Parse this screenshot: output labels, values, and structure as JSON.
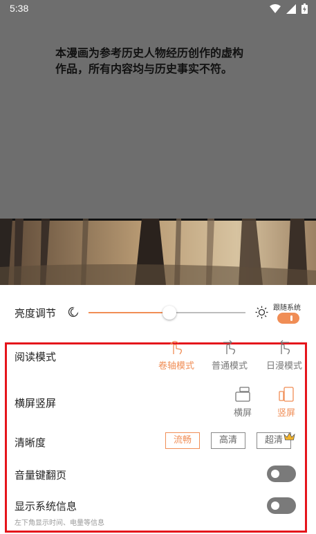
{
  "status": {
    "time": "5:38"
  },
  "disclaimer": {
    "line1": "本漫画为参考历史人物经历创作的虚构",
    "line2": "作品，所有内容均与历史事实不符。"
  },
  "brightness": {
    "label": "亮度调节",
    "follow_system_label": "跟随系统",
    "level": 0.5,
    "follow_system_on": true
  },
  "reading_mode": {
    "label": "阅读模式",
    "options": [
      {
        "label": "卷轴模式",
        "icon": "scroll-hand-icon",
        "active": true
      },
      {
        "label": "普通模式",
        "icon": "swipe-hand-icon",
        "active": false
      },
      {
        "label": "日漫模式",
        "icon": "swipe-back-hand-icon",
        "active": false
      }
    ]
  },
  "orientation": {
    "label": "横屏竖屏",
    "options": [
      {
        "label": "横屏",
        "icon": "landscape-icon",
        "active": false
      },
      {
        "label": "竖屏",
        "icon": "portrait-icon",
        "active": true
      }
    ]
  },
  "quality": {
    "label": "清晰度",
    "options": [
      {
        "label": "流畅",
        "active": true
      },
      {
        "label": "高清",
        "active": false
      },
      {
        "label": "超清",
        "active": false,
        "badge": "crown-icon"
      }
    ]
  },
  "volume_page": {
    "label": "音量键翻页",
    "on": false
  },
  "system_info": {
    "label": "显示系统信息",
    "desc": "左下角显示时间、电量等信息",
    "on": false
  },
  "colors": {
    "accent": "#f08d55",
    "highlight_box": "#e5141b"
  }
}
